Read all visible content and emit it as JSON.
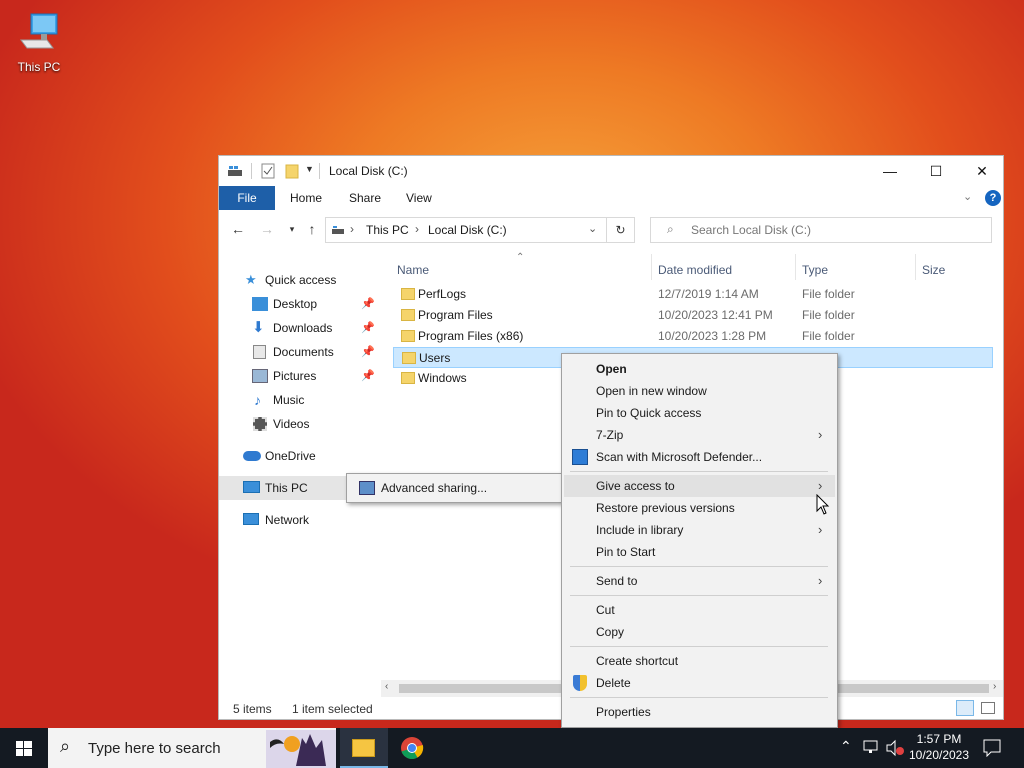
{
  "desktop": {
    "icon_label": "This PC"
  },
  "window": {
    "title": "Local Disk (C:)",
    "ribbon_tabs": [
      "File",
      "Home",
      "Share",
      "View"
    ],
    "help": "?",
    "address": {
      "segments": [
        "This PC",
        "Local Disk (C:)"
      ]
    },
    "search_placeholder": "Search Local Disk (C:)"
  },
  "nav_pane": {
    "quick_access": "Quick access",
    "items": [
      {
        "label": "Desktop",
        "pinned": true
      },
      {
        "label": "Downloads",
        "pinned": true
      },
      {
        "label": "Documents",
        "pinned": true
      },
      {
        "label": "Pictures",
        "pinned": true
      },
      {
        "label": "Music",
        "pinned": false
      },
      {
        "label": "Videos",
        "pinned": false
      }
    ],
    "onedrive": "OneDrive",
    "this_pc": "This PC",
    "network": "Network"
  },
  "file_list": {
    "columns": [
      "Name",
      "Date modified",
      "Type",
      "Size"
    ],
    "rows": [
      {
        "name": "PerfLogs",
        "date": "12/7/2019 1:14 AM",
        "type": "File folder"
      },
      {
        "name": "Program Files",
        "date": "10/20/2023 12:41 PM",
        "type": "File folder"
      },
      {
        "name": "Program Files (x86)",
        "date": "10/20/2023 1:28 PM",
        "type": "File folder"
      },
      {
        "name": "Users",
        "date": "",
        "type": "",
        "selected": true
      },
      {
        "name": "Windows",
        "date": "",
        "type": ""
      }
    ]
  },
  "status": {
    "items": "5 items",
    "selected": "1 item selected"
  },
  "context_menu": {
    "items": [
      "Open",
      "Open in new window",
      "Pin to Quick access",
      "7-Zip",
      "Scan with Microsoft Defender...",
      "Give access to",
      "Restore previous versions",
      "Include in library",
      "Pin to Start",
      "Send to",
      "Cut",
      "Copy",
      "Create shortcut",
      "Delete",
      "Properties"
    ]
  },
  "submenu": {
    "item": "Advanced sharing..."
  },
  "taskbar": {
    "search_placeholder": "Type here to search",
    "time": "1:57 PM",
    "date": "10/20/2023"
  },
  "colors": {
    "accent": "#1e5fa8",
    "selection": "#cce8ff",
    "taskbar": "#141a22"
  }
}
